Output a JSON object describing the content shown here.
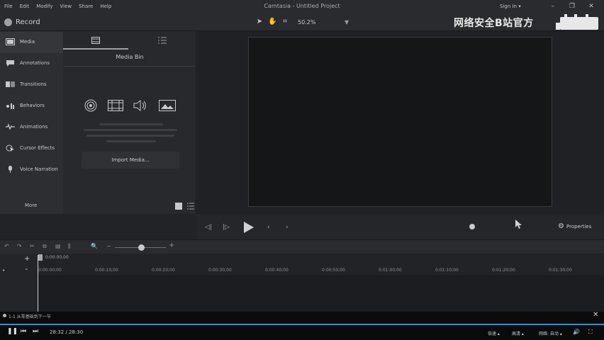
{
  "window": {
    "menu": [
      "File",
      "Edit",
      "Modify",
      "View",
      "Share",
      "Help"
    ],
    "title": "Camtasia - Untitled Project",
    "signin": "Sign In ▾"
  },
  "toolbar": {
    "record_label": "Record",
    "zoom_value": "50.2%",
    "watermark": "网络安全B站官方"
  },
  "sidebar": {
    "items": [
      {
        "label": "Media",
        "icon": "media-icon"
      },
      {
        "label": "Annotations",
        "icon": "annotations-icon"
      },
      {
        "label": "Transitions",
        "icon": "transitions-icon"
      },
      {
        "label": "Behaviors",
        "icon": "behaviors-icon"
      },
      {
        "label": "Animations",
        "icon": "animations-icon"
      },
      {
        "label": "Cursor Effects",
        "icon": "cursor-effects-icon"
      },
      {
        "label": "Voice Narration",
        "icon": "voice-narration-icon"
      }
    ],
    "more_label": "More"
  },
  "media_bin": {
    "title": "Media Bin",
    "import_label": "Import Media..."
  },
  "playback": {
    "properties_label": "Properties"
  },
  "timeline": {
    "playhead_time": "0:00:00;00",
    "ticks": [
      "0:00:00;00",
      "0:00:10;00",
      "0:00:20;00",
      "0:00:30;00",
      "0:00:40;00",
      "0:00:50;00",
      "0:01:00;00",
      "0:01:10;00",
      "0:01:20;00",
      "0:01:30;00"
    ]
  },
  "player": {
    "title": "1-1 从零基础到下一节",
    "time": "28:32 / 28:30",
    "right_controls": [
      "倍速 ▴",
      "高清 ▴",
      "网络: 自动 ▴"
    ]
  }
}
